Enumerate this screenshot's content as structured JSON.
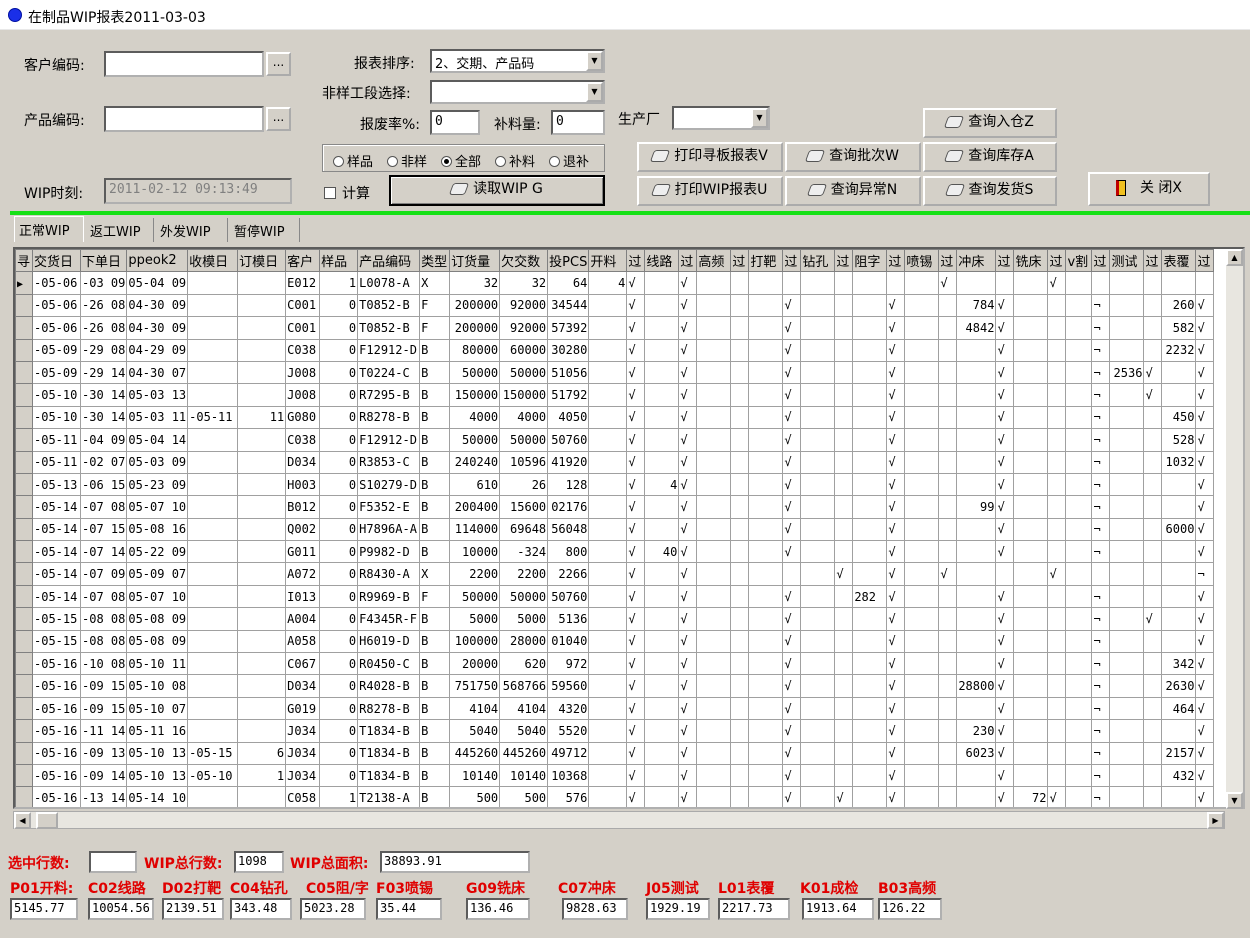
{
  "window": {
    "title": "在制品WIP报表2011-03-03"
  },
  "filters": {
    "customer_code_label": "客户编码:",
    "customer_code_value": "",
    "product_code_label": "产品编码:",
    "product_code_value": "",
    "wip_time_label": "WIP时刻:",
    "wip_time_value": "2011-02-12 09:13:49",
    "dots_label": "...",
    "sort_label": "报表排序:",
    "sort_value": "2、交期、产品码",
    "stage_label": "非样工段选择:",
    "stage_value": "",
    "scrap_rate_label": "报废率%:",
    "scrap_rate_value": "0",
    "supplement_label": "补料量:",
    "supplement_value": "0",
    "factory_label": "生产厂",
    "factory_value": "",
    "radios": [
      "样品",
      "非样",
      "全部",
      "补料",
      "退补"
    ],
    "radio_selected": "全部",
    "calc_label": "计算",
    "read_wip_button": "读取WIP G"
  },
  "buttons": {
    "print_board": "打印寻板报表V",
    "query_batch": "查询批次W",
    "query_in": "查询入仓Z",
    "query_stock": "查询库存A",
    "print_wip": "打印WIP报表U",
    "query_exception": "查询异常N",
    "query_ship": "查询发货S",
    "close": "关 闭X"
  },
  "tabs": [
    "正常WIP",
    "返工WIP",
    "外发WIP",
    "暂停WIP"
  ],
  "active_tab": "正常WIP",
  "grid": {
    "columns": [
      "寻",
      "交货日",
      "下单日",
      "ppeok2",
      "收模日",
      "订模日",
      "客户",
      "样品",
      "产品编码",
      "类型",
      "订货量",
      "欠交数",
      "投PCS",
      "开料",
      "过",
      "线路",
      "过",
      "高频",
      "过",
      "打靶",
      "过",
      "钻孔",
      "过",
      "阻字",
      "过",
      "喷锡",
      "过",
      "冲床",
      "过",
      "铣床",
      "过",
      "v割",
      "过",
      "测试",
      "过",
      "表覆",
      "过"
    ],
    "rows": [
      [
        "",
        "-05-06",
        "-03 09",
        "05-04 09",
        "",
        "",
        "E012",
        "1",
        "L0078-A",
        "X",
        "32",
        "32",
        "64",
        "4",
        "√",
        "",
        "√",
        "",
        "",
        "",
        "",
        "",
        "",
        "",
        "",
        "",
        "√",
        "",
        "",
        "",
        "√",
        "",
        "",
        "",
        "",
        "",
        ""
      ],
      [
        "",
        "-05-06",
        "-26 08",
        "04-30 09",
        "",
        "",
        "C001",
        "0",
        "T0852-B",
        "F",
        "200000",
        "92000",
        "34544",
        "",
        "√",
        "",
        "√",
        "",
        "",
        "",
        "√",
        "",
        "",
        "",
        "√",
        "",
        "",
        "784",
        "√",
        "",
        "",
        "",
        "¬",
        "",
        "",
        "260",
        "√"
      ],
      [
        "",
        "-05-06",
        "-26 08",
        "04-30 09",
        "",
        "",
        "C001",
        "0",
        "T0852-B",
        "F",
        "200000",
        "92000",
        "57392",
        "",
        "√",
        "",
        "√",
        "",
        "",
        "",
        "√",
        "",
        "",
        "",
        "√",
        "",
        "",
        "4842",
        "√",
        "",
        "",
        "",
        "¬",
        "",
        "",
        "582",
        "√"
      ],
      [
        "",
        "-05-09",
        "-29 08",
        "04-29 09",
        "",
        "",
        "C038",
        "0",
        "F12912-D",
        "B",
        "80000",
        "60000",
        "30280",
        "",
        "√",
        "",
        "√",
        "",
        "",
        "",
        "√",
        "",
        "",
        "",
        "√",
        "",
        "",
        "",
        "√",
        "",
        "",
        "",
        "¬",
        "",
        "",
        "2232",
        "√"
      ],
      [
        "",
        "-05-09",
        "-29 14",
        "04-30 07",
        "",
        "",
        "J008",
        "0",
        "T0224-C",
        "B",
        "50000",
        "50000",
        "51056",
        "",
        "√",
        "",
        "√",
        "",
        "",
        "",
        "√",
        "",
        "",
        "",
        "√",
        "",
        "",
        "",
        "√",
        "",
        "",
        "",
        "¬",
        "2536",
        "√",
        "",
        "√"
      ],
      [
        "",
        "-05-10",
        "-30 14",
        "05-03 13",
        "",
        "",
        "J008",
        "0",
        "R7295-B",
        "B",
        "150000",
        "150000",
        "51792",
        "",
        "√",
        "",
        "√",
        "",
        "",
        "",
        "√",
        "",
        "",
        "",
        "√",
        "",
        "",
        "",
        "√",
        "",
        "",
        "",
        "¬",
        "",
        "√",
        "",
        "√"
      ],
      [
        "",
        "-05-10",
        "-30 14",
        "05-03 11",
        "-05-11",
        "11",
        "G080",
        "0",
        "R8278-B",
        "B",
        "4000",
        "4000",
        "4050",
        "",
        "√",
        "",
        "√",
        "",
        "",
        "",
        "√",
        "",
        "",
        "",
        "√",
        "",
        "",
        "",
        "√",
        "",
        "",
        "",
        "¬",
        "",
        "",
        "450",
        "√"
      ],
      [
        "",
        "-05-11",
        "-04 09",
        "05-04 14",
        "",
        "",
        "C038",
        "0",
        "F12912-D",
        "B",
        "50000",
        "50000",
        "50760",
        "",
        "√",
        "",
        "√",
        "",
        "",
        "",
        "√",
        "",
        "",
        "",
        "√",
        "",
        "",
        "",
        "√",
        "",
        "",
        "",
        "¬",
        "",
        "",
        "528",
        "√"
      ],
      [
        "",
        "-05-11",
        "-02 07",
        "05-03 09",
        "",
        "",
        "D034",
        "0",
        "R3853-C",
        "B",
        "240240",
        "10596",
        "41920",
        "",
        "√",
        "",
        "√",
        "",
        "",
        "",
        "√",
        "",
        "",
        "",
        "√",
        "",
        "",
        "",
        "√",
        "",
        "",
        "",
        "¬",
        "",
        "",
        "1032",
        "√"
      ],
      [
        "",
        "-05-13",
        "-06 15",
        "05-23 09",
        "",
        "",
        "H003",
        "0",
        "S10279-D",
        "B",
        "610",
        "26",
        "128",
        "",
        "√",
        "4",
        "√",
        "",
        "",
        "",
        "√",
        "",
        "",
        "",
        "√",
        "",
        "",
        "",
        "√",
        "",
        "",
        "",
        "¬",
        "",
        "",
        "",
        "√"
      ],
      [
        "",
        "-05-14",
        "-07 08",
        "05-07 10",
        "",
        "",
        "B012",
        "0",
        "F5352-E",
        "B",
        "200400",
        "15600",
        "02176",
        "",
        "√",
        "",
        "√",
        "",
        "",
        "",
        "√",
        "",
        "",
        "",
        "√",
        "",
        "",
        "99",
        "√",
        "",
        "",
        "",
        "¬",
        "",
        "",
        "",
        "√"
      ],
      [
        "",
        "-05-14",
        "-07 15",
        "05-08 16",
        "",
        "",
        "Q002",
        "0",
        "H7896A-A",
        "B",
        "114000",
        "69648",
        "56048",
        "",
        "√",
        "",
        "√",
        "",
        "",
        "",
        "√",
        "",
        "",
        "",
        "√",
        "",
        "",
        "",
        "√",
        "",
        "",
        "",
        "¬",
        "",
        "",
        "6000",
        "√"
      ],
      [
        "",
        "-05-14",
        "-07 14",
        "05-22 09",
        "",
        "",
        "G011",
        "0",
        "P9982-D",
        "B",
        "10000",
        "-324",
        "800",
        "",
        "√",
        "40",
        "√",
        "",
        "",
        "",
        "√",
        "",
        "",
        "",
        "√",
        "",
        "",
        "",
        "√",
        "",
        "",
        "",
        "¬",
        "",
        "",
        "",
        "√"
      ],
      [
        "",
        "-05-14",
        "-07 09",
        "05-09 07",
        "",
        "",
        "A072",
        "0",
        "R8430-A",
        "X",
        "2200",
        "2200",
        "2266",
        "",
        "√",
        "",
        "√",
        "",
        "",
        "",
        "",
        "",
        "√",
        "",
        "√",
        "",
        "√",
        "",
        "",
        "",
        "√",
        "",
        "",
        "",
        "",
        "",
        "¬"
      ],
      [
        "",
        "-05-14",
        "-07 08",
        "05-07 10",
        "",
        "",
        "I013",
        "0",
        "R9969-B",
        "F",
        "50000",
        "50000",
        "50760",
        "",
        "√",
        "",
        "√",
        "",
        "",
        "",
        "√",
        "",
        "",
        "282",
        "√",
        "",
        "",
        "",
        "√",
        "",
        "",
        "",
        "¬",
        "",
        "",
        "",
        "√"
      ],
      [
        "",
        "-05-15",
        "-08 08",
        "05-08 09",
        "",
        "",
        "A004",
        "0",
        "F4345R-F",
        "B",
        "5000",
        "5000",
        "5136",
        "",
        "√",
        "",
        "√",
        "",
        "",
        "",
        "√",
        "",
        "",
        "",
        "√",
        "",
        "",
        "",
        "√",
        "",
        "",
        "",
        "¬",
        "",
        "√",
        "",
        "√"
      ],
      [
        "",
        "-05-15",
        "-08 08",
        "05-08 09",
        "",
        "",
        "A058",
        "0",
        "H6019-D",
        "B",
        "100000",
        "28000",
        "01040",
        "",
        "√",
        "",
        "√",
        "",
        "",
        "",
        "√",
        "",
        "",
        "",
        "√",
        "",
        "",
        "",
        "√",
        "",
        "",
        "",
        "¬",
        "",
        "",
        "",
        "√"
      ],
      [
        "",
        "-05-16",
        "-10 08",
        "05-10 11",
        "",
        "",
        "C067",
        "0",
        "R0450-C",
        "B",
        "20000",
        "620",
        "972",
        "",
        "√",
        "",
        "√",
        "",
        "",
        "",
        "√",
        "",
        "",
        "",
        "√",
        "",
        "",
        "",
        "√",
        "",
        "",
        "",
        "¬",
        "",
        "",
        "342",
        "√"
      ],
      [
        "",
        "-05-16",
        "-09 15",
        "05-10 08",
        "",
        "",
        "D034",
        "0",
        "R4028-B",
        "B",
        "751750",
        "568766",
        "59560",
        "",
        "√",
        "",
        "√",
        "",
        "",
        "",
        "√",
        "",
        "",
        "",
        "√",
        "",
        "",
        "28800",
        "√",
        "",
        "",
        "",
        "¬",
        "",
        "",
        "2630",
        "√"
      ],
      [
        "",
        "-05-16",
        "-09 15",
        "05-10 07",
        "",
        "",
        "G019",
        "0",
        "R8278-B",
        "B",
        "4104",
        "4104",
        "4320",
        "",
        "√",
        "",
        "√",
        "",
        "",
        "",
        "√",
        "",
        "",
        "",
        "√",
        "",
        "",
        "",
        "√",
        "",
        "",
        "",
        "¬",
        "",
        "",
        "464",
        "√"
      ],
      [
        "",
        "-05-16",
        "-11 14",
        "05-11 16",
        "",
        "",
        "J034",
        "0",
        "T1834-B",
        "B",
        "5040",
        "5040",
        "5520",
        "",
        "√",
        "",
        "√",
        "",
        "",
        "",
        "√",
        "",
        "",
        "",
        "√",
        "",
        "",
        "230",
        "√",
        "",
        "",
        "",
        "¬",
        "",
        "",
        "",
        "√"
      ],
      [
        "",
        "-05-16",
        "-09 13",
        "05-10 13",
        "-05-15",
        "6",
        "J034",
        "0",
        "T1834-B",
        "B",
        "445260",
        "445260",
        "49712",
        "",
        "√",
        "",
        "√",
        "",
        "",
        "",
        "√",
        "",
        "",
        "",
        "√",
        "",
        "",
        "6023",
        "√",
        "",
        "",
        "",
        "¬",
        "",
        "",
        "2157",
        "√"
      ],
      [
        "",
        "-05-16",
        "-09 14",
        "05-10 13",
        "-05-10",
        "1",
        "J034",
        "0",
        "T1834-B",
        "B",
        "10140",
        "10140",
        "10368",
        "",
        "√",
        "",
        "√",
        "",
        "",
        "",
        "√",
        "",
        "",
        "",
        "√",
        "",
        "",
        "",
        "√",
        "",
        "",
        "",
        "¬",
        "",
        "",
        "432",
        "√"
      ],
      [
        "",
        "-05-16",
        "-13 14",
        "05-14 10",
        "",
        "",
        "C058",
        "1",
        "T2138-A",
        "B",
        "500",
        "500",
        "576",
        "",
        "√",
        "",
        "√",
        "",
        "",
        "",
        "√",
        "",
        "√",
        "",
        "√",
        "",
        "",
        "",
        "√",
        "72",
        "√",
        "",
        "¬",
        "",
        "",
        "",
        "√"
      ]
    ]
  },
  "summary": {
    "selected_rows_label": "选中行数:",
    "selected_rows_value": "",
    "wip_total_rows_label": "WIP总行数:",
    "wip_total_rows_value": "1098",
    "wip_total_area_label": "WIP总面积:",
    "wip_total_area_value": "38893.91",
    "stations": [
      {
        "label": "P01开料:",
        "value": "5145.77"
      },
      {
        "label": "C02线路",
        "value": "10054.56"
      },
      {
        "label": "D02打靶",
        "value": "2139.51"
      },
      {
        "label": "C04钻孔",
        "value": "343.48"
      },
      {
        "label": "C05阻/字",
        "value": "5023.28"
      },
      {
        "label": "F03喷锡",
        "value": "35.44"
      },
      {
        "label": "G09铣床",
        "value": "136.46"
      },
      {
        "label": "C07冲床",
        "value": "9828.63"
      },
      {
        "label": "J05测试",
        "value": "1929.19"
      },
      {
        "label": "L01表覆",
        "value": "2217.73"
      },
      {
        "label": "K01成检",
        "value": "1913.64"
      },
      {
        "label": "B03高频",
        "value": "126.22"
      }
    ]
  }
}
